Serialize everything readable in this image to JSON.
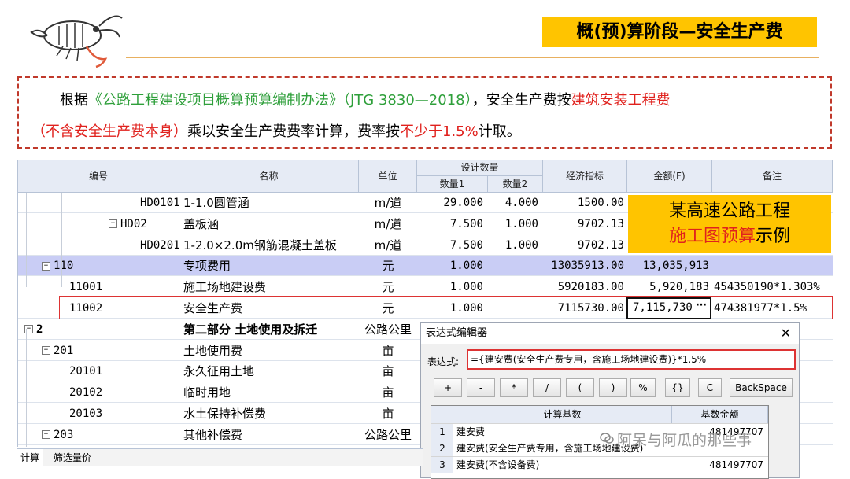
{
  "header": {
    "title": "概(预)算阶段—安全生产费"
  },
  "note": {
    "line1_prefix": "根据",
    "line1_doc": "《公路工程建设项目概算预算编制办法》（JTG 3830—2018）",
    "line1_mid": "，安全生产费按",
    "line1_red": "建筑安装工程费",
    "line2_red1": "（不含安全生产费本身）",
    "line2_mid": "乘以安全生产费费率计算，费率按",
    "line2_red2": "不少于1.5%",
    "line2_end": "计取。"
  },
  "grid": {
    "headers": {
      "code": "编号",
      "name": "名称",
      "unit": "单位",
      "design_qty": "设计数量",
      "qty1": "数量1",
      "qty2": "数量2",
      "econ": "经济指标",
      "amount": "金额(F)",
      "remark": "备注"
    },
    "rows": [
      {
        "code": "HD0101",
        "name": "1-1.0圆管涵",
        "unit": "m/道",
        "qty1": "29.000",
        "qty2": "4.000",
        "econ": "1500.00",
        "amount": "",
        "remark": ""
      },
      {
        "code": "HD02",
        "name": "盖板涵",
        "unit": "m/道",
        "qty1": "7.500",
        "qty2": "1.000",
        "econ": "9702.13",
        "amount": "",
        "remark": ""
      },
      {
        "code": "HD0201",
        "name": "1-2.0×2.0m钢筋混凝土盖板",
        "unit": "m/道",
        "qty1": "7.500",
        "qty2": "1.000",
        "econ": "9702.13",
        "amount": "",
        "remark": ""
      },
      {
        "code": "110",
        "name": "专项费用",
        "unit": "元",
        "qty1": "1.000",
        "qty2": "",
        "econ": "13035913.00",
        "amount": "13,035,913",
        "remark": ""
      },
      {
        "code": "11001",
        "name": "施工场地建设费",
        "unit": "元",
        "qty1": "1.000",
        "qty2": "",
        "econ": "5920183.00",
        "amount": "5,920,183",
        "remark": "454350190*1.303%"
      },
      {
        "code": "11002",
        "name": "安全生产费",
        "unit": "元",
        "qty1": "1.000",
        "qty2": "",
        "econ": "7115730.00",
        "amount": "7,115,730",
        "remark": "474381977*1.5%"
      },
      {
        "code": "2",
        "name": "第二部分 土地使用及拆迁",
        "unit": "公路公里",
        "qty1": "",
        "qty2": "",
        "econ": "",
        "amount": "",
        "remark": ""
      },
      {
        "code": "201",
        "name": "土地使用费",
        "unit": "亩",
        "qty1": "",
        "qty2": "",
        "econ": "",
        "amount": "",
        "remark": ""
      },
      {
        "code": "20101",
        "name": "永久征用土地",
        "unit": "亩",
        "qty1": "",
        "qty2": "",
        "econ": "",
        "amount": "",
        "remark": ""
      },
      {
        "code": "20102",
        "name": "临时用地",
        "unit": "亩",
        "qty1": "",
        "qty2": "",
        "econ": "",
        "amount": "",
        "remark": ""
      },
      {
        "code": "20103",
        "name": "水土保持补偿费",
        "unit": "亩",
        "qty1": "",
        "qty2": "",
        "econ": "",
        "amount": "",
        "remark": ""
      },
      {
        "code": "203",
        "name": "其他补偿费",
        "unit": "公路公里",
        "qty1": "",
        "qty2": "",
        "econ": "",
        "amount": "",
        "remark": ""
      }
    ],
    "ellipsis": "⋯"
  },
  "example": {
    "line1": "某高速公路工程",
    "line2_red": "施工图预算",
    "line2_end": "示例"
  },
  "dialog": {
    "title": "表达式编辑器",
    "close": "✕",
    "expr_label": "表达式:",
    "expr_value": "={建安费(安全生产费专用，含施工场地建设费)}*1.5%",
    "buttons": [
      "+",
      "-",
      "*",
      "/",
      "(",
      ")",
      "%",
      "{}",
      "C",
      "BackSpace"
    ],
    "table_headers": {
      "basis": "计算基数",
      "amount": "基数金额"
    },
    "table_rows": [
      {
        "no": "1",
        "basis": "建安费",
        "amount": "481497707"
      },
      {
        "no": "2",
        "basis": "建安费(安全生产费专用，含施工场地建设费)",
        "amount": ""
      },
      {
        "no": "3",
        "basis": "建安费(不含设备费)",
        "amount": "481497707"
      }
    ]
  },
  "statusbar": {
    "tab1": "计算",
    "tab2": "筛选量价"
  },
  "watermark": {
    "text": "阿呆与阿瓜的那些事"
  },
  "colors": {
    "accent": "#ffc400",
    "red": "#e0211d",
    "green": "#2e9f3a",
    "selected_row": "#c9cdf5"
  }
}
